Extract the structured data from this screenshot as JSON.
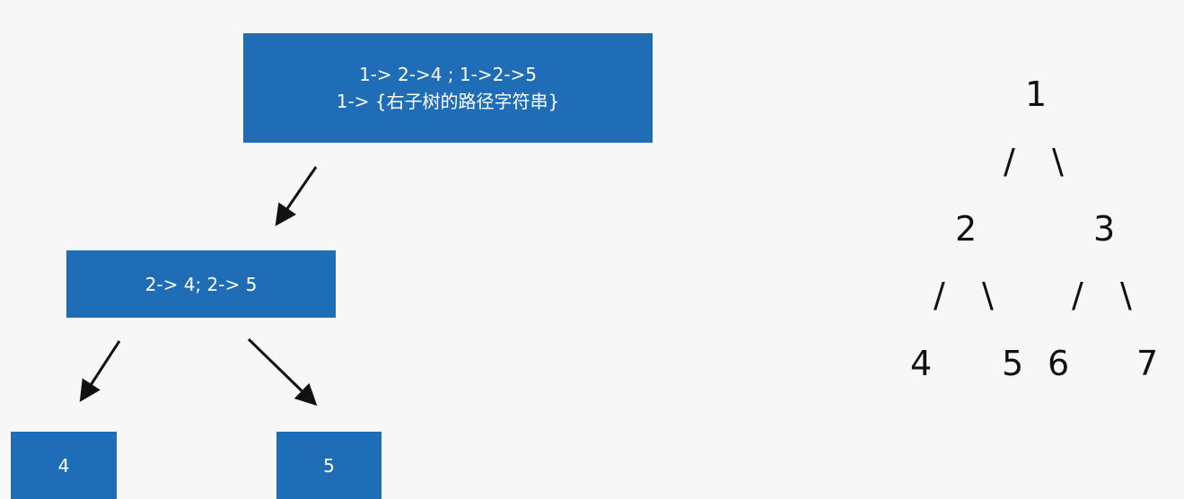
{
  "diagram": {
    "root_box": {
      "line1": "1-> 2->4 ; 1->2->5",
      "line2": "1-> {右子树的路径字符串}"
    },
    "middle_box": {
      "text": "2-> 4;  2-> 5"
    },
    "leaf_left_box": {
      "text": "4"
    },
    "leaf_right_box": {
      "text": "5"
    }
  },
  "tree": {
    "n1": "1",
    "n2": "2",
    "n3": "3",
    "n4": "4",
    "n5": "5",
    "n6": "6",
    "n7": "7",
    "slash": "/",
    "backslash": "\\"
  }
}
